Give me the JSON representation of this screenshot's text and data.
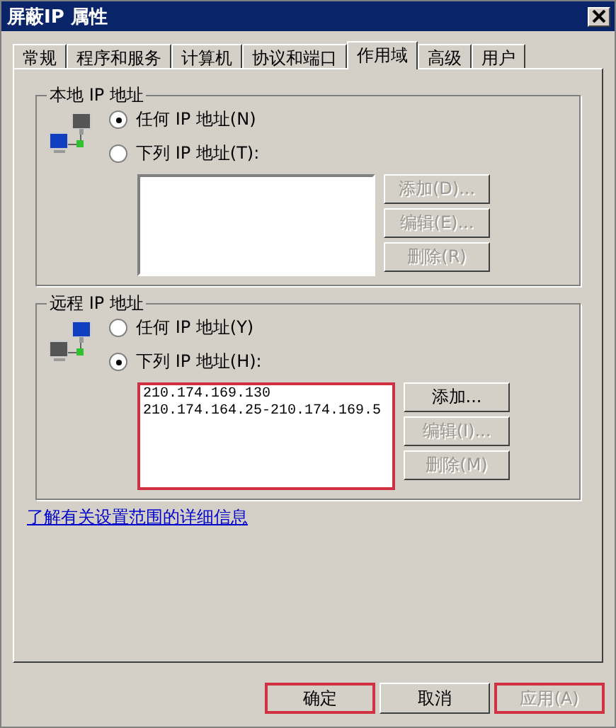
{
  "window": {
    "title": "屏蔽IP 属性"
  },
  "tabs": [
    {
      "label": "常规",
      "selected": false
    },
    {
      "label": "程序和服务",
      "selected": false
    },
    {
      "label": "计算机",
      "selected": false
    },
    {
      "label": "协议和端口",
      "selected": false
    },
    {
      "label": "作用域",
      "selected": true
    },
    {
      "label": "高级",
      "selected": false
    },
    {
      "label": "用户",
      "selected": false
    }
  ],
  "groups": [
    {
      "title": "本地 IP 地址",
      "kind": "local",
      "options": [
        {
          "label": "任何 IP 地址(N)",
          "selected": true
        },
        {
          "label": "下列 IP 地址(T):",
          "selected": false
        }
      ],
      "highlighted": false,
      "buttons": [
        {
          "label": "添加(D)...",
          "disabled": true
        },
        {
          "label": "编辑(E)...",
          "disabled": true
        },
        {
          "label": "删除(R)",
          "disabled": true
        }
      ]
    },
    {
      "title": "远程 IP 地址",
      "kind": "remote",
      "options": [
        {
          "label": "任何 IP 地址(Y)",
          "selected": false
        },
        {
          "label": "下列 IP 地址(H):",
          "selected": true
        }
      ],
      "addresses": [
        "210.174.169.130",
        "210.174.164.25-210.174.169.5"
      ],
      "highlighted": true,
      "buttons": [
        {
          "label": "添加...",
          "disabled": false
        },
        {
          "label": "编辑(I)...",
          "disabled": true
        },
        {
          "label": "删除(M)",
          "disabled": true
        }
      ]
    }
  ],
  "link": "了解有关设置范围的详细信息",
  "buttons": [
    {
      "label": "确定",
      "disabled": false,
      "highlighted": true
    },
    {
      "label": "取消",
      "disabled": false,
      "highlighted": false
    },
    {
      "label": "应用(A)",
      "disabled": true,
      "highlighted": true
    }
  ]
}
